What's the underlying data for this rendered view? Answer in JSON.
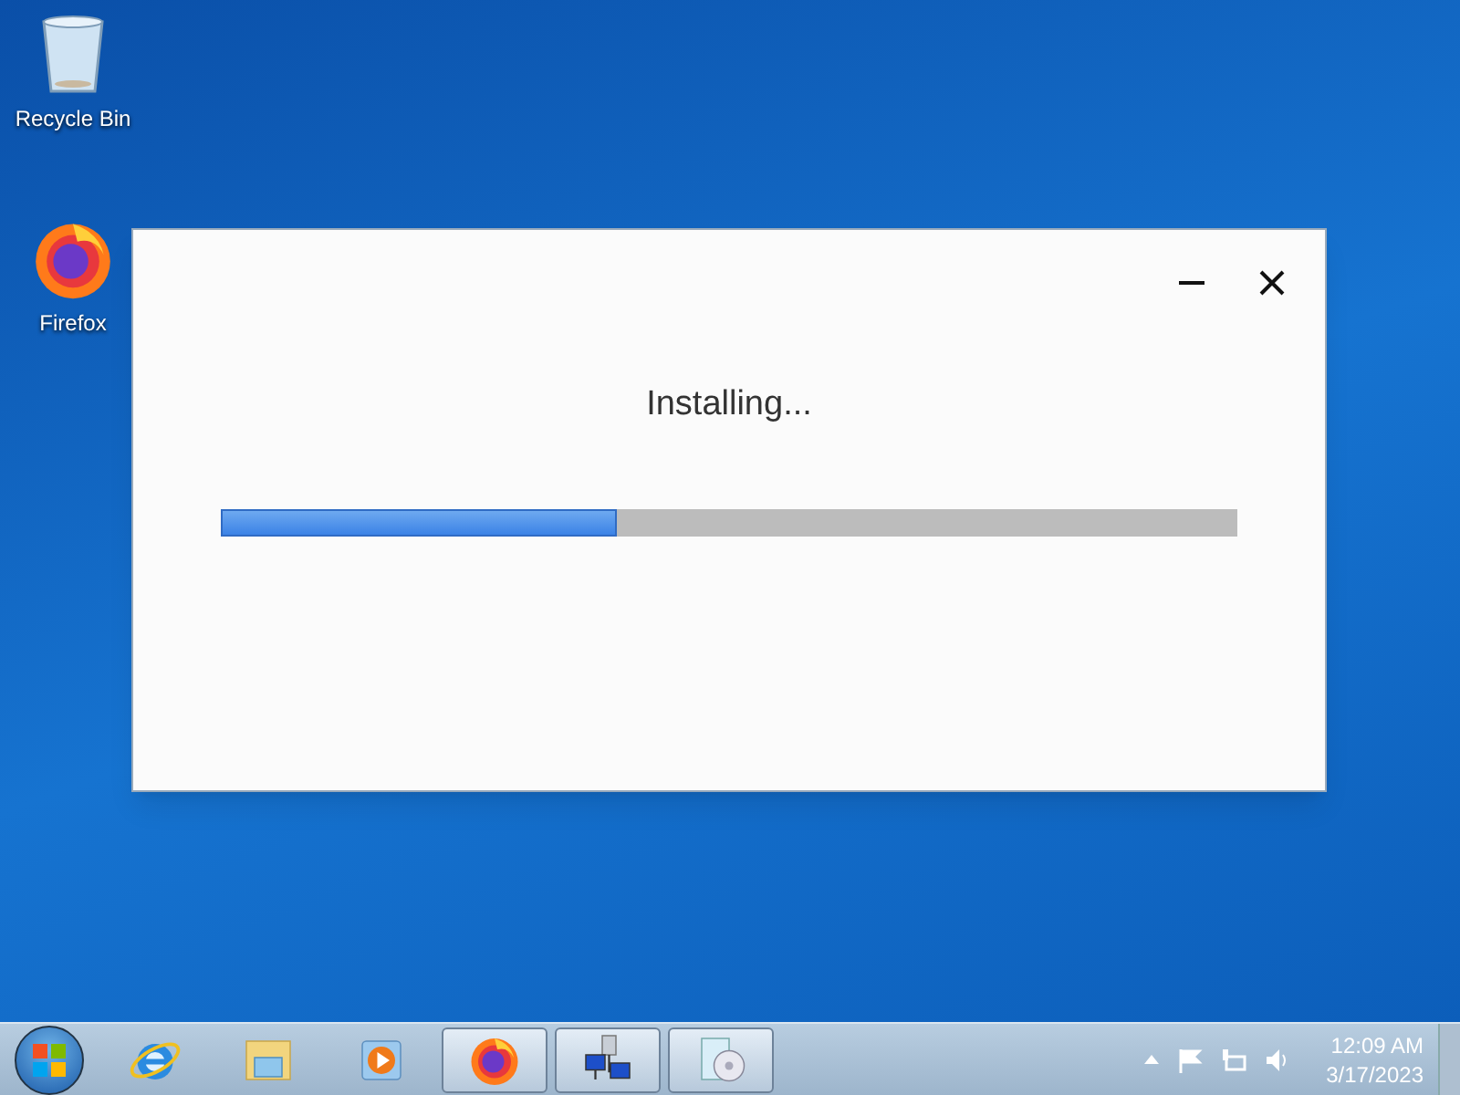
{
  "desktop_icons": [
    {
      "kind": "recycle",
      "label": "Recycle Bin"
    },
    {
      "kind": "firefox",
      "label": "Firefox"
    }
  ],
  "dialog": {
    "status": "Installing...",
    "progress": {
      "level": 0.39
    }
  },
  "taskbar": {
    "items": [
      {
        "kind": "ie",
        "running": false
      },
      {
        "kind": "folder",
        "running": false
      },
      {
        "kind": "media",
        "running": false
      },
      {
        "kind": "firefox",
        "running": true
      },
      {
        "kind": "network",
        "running": true
      },
      {
        "kind": "disc",
        "running": true
      }
    ],
    "clock": {
      "time": "12:09 AM",
      "date": "3/17/2023"
    }
  }
}
